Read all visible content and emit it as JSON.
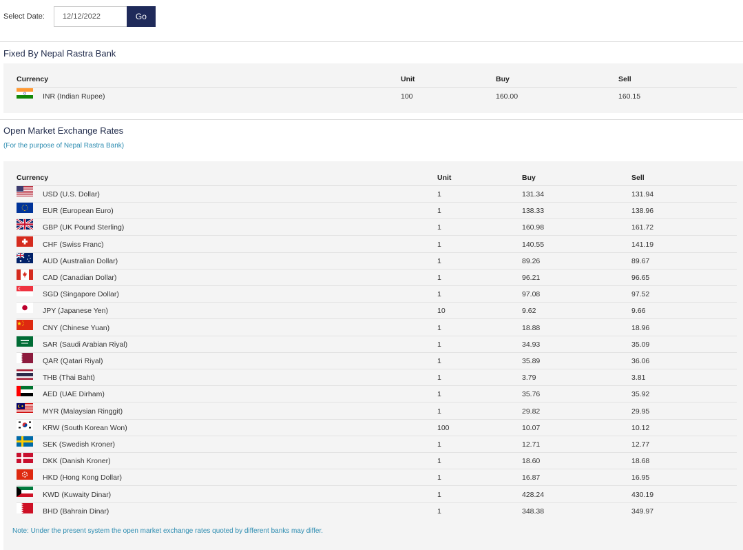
{
  "date_picker": {
    "label": "Select Date:",
    "value": "12/12/2022",
    "go_label": "Go"
  },
  "fixed": {
    "title": "Fixed By Nepal Rastra Bank",
    "headers": {
      "currency": "Currency",
      "unit": "Unit",
      "buy": "Buy",
      "sell": "Sell"
    },
    "rows": [
      {
        "flag": "india-flag-icon",
        "currency": "INR (Indian Rupee)",
        "unit": "100",
        "buy": "160.00",
        "sell": "160.15"
      }
    ]
  },
  "open_market": {
    "title": "Open Market Exchange Rates",
    "subtitle": "(For the purpose of Nepal Rastra Bank)",
    "headers": {
      "currency": "Currency",
      "unit": "Unit",
      "buy": "Buy",
      "sell": "Sell"
    },
    "rows": [
      {
        "flag": "usa-flag-icon",
        "currency": "USD (U.S. Dollar)",
        "unit": "1",
        "buy": "131.34",
        "sell": "131.94"
      },
      {
        "flag": "eu-flag-icon",
        "currency": "EUR (European Euro)",
        "unit": "1",
        "buy": "138.33",
        "sell": "138.96"
      },
      {
        "flag": "uk-flag-icon",
        "currency": "GBP (UK Pound Sterling)",
        "unit": "1",
        "buy": "160.98",
        "sell": "161.72"
      },
      {
        "flag": "switzerland-flag-icon",
        "currency": "CHF (Swiss Franc)",
        "unit": "1",
        "buy": "140.55",
        "sell": "141.19"
      },
      {
        "flag": "australia-flag-icon",
        "currency": "AUD (Australian Dollar)",
        "unit": "1",
        "buy": "89.26",
        "sell": "89.67"
      },
      {
        "flag": "canada-flag-icon",
        "currency": "CAD (Canadian Dollar)",
        "unit": "1",
        "buy": "96.21",
        "sell": "96.65"
      },
      {
        "flag": "singapore-flag-icon",
        "currency": "SGD (Singapore Dollar)",
        "unit": "1",
        "buy": "97.08",
        "sell": "97.52"
      },
      {
        "flag": "japan-flag-icon",
        "currency": "JPY (Japanese Yen)",
        "unit": "10",
        "buy": "9.62",
        "sell": "9.66"
      },
      {
        "flag": "china-flag-icon",
        "currency": "CNY (Chinese Yuan)",
        "unit": "1",
        "buy": "18.88",
        "sell": "18.96"
      },
      {
        "flag": "saudi-flag-icon",
        "currency": "SAR (Saudi Arabian Riyal)",
        "unit": "1",
        "buy": "34.93",
        "sell": "35.09"
      },
      {
        "flag": "qatar-flag-icon",
        "currency": "QAR (Qatari Riyal)",
        "unit": "1",
        "buy": "35.89",
        "sell": "36.06"
      },
      {
        "flag": "thailand-flag-icon",
        "currency": "THB (Thai Baht)",
        "unit": "1",
        "buy": "3.79",
        "sell": "3.81"
      },
      {
        "flag": "uae-flag-icon",
        "currency": "AED (UAE Dirham)",
        "unit": "1",
        "buy": "35.76",
        "sell": "35.92"
      },
      {
        "flag": "malaysia-flag-icon",
        "currency": "MYR (Malaysian Ringgit)",
        "unit": "1",
        "buy": "29.82",
        "sell": "29.95"
      },
      {
        "flag": "south-korea-flag-icon",
        "currency": "KRW (South Korean Won)",
        "unit": "100",
        "buy": "10.07",
        "sell": "10.12"
      },
      {
        "flag": "sweden-flag-icon",
        "currency": "SEK (Swedish Kroner)",
        "unit": "1",
        "buy": "12.71",
        "sell": "12.77"
      },
      {
        "flag": "denmark-flag-icon",
        "currency": "DKK (Danish Kroner)",
        "unit": "1",
        "buy": "18.60",
        "sell": "18.68"
      },
      {
        "flag": "hong-kong-flag-icon",
        "currency": "HKD (Hong Kong Dollar)",
        "unit": "1",
        "buy": "16.87",
        "sell": "16.95"
      },
      {
        "flag": "kuwait-flag-icon",
        "currency": "KWD (Kuwaity Dinar)",
        "unit": "1",
        "buy": "428.24",
        "sell": "430.19"
      },
      {
        "flag": "bahrain-flag-icon",
        "currency": "BHD (Bahrain Dinar)",
        "unit": "1",
        "buy": "348.38",
        "sell": "349.97"
      }
    ],
    "note": "Note: Under the present system the open market exchange rates quoted by different banks may differ."
  },
  "colors": {
    "button_bg": "#1f2a5a",
    "panel_bg": "#f4f4f4",
    "link_blue": "#2a8bb0",
    "title_navy": "#1f2a4a"
  }
}
